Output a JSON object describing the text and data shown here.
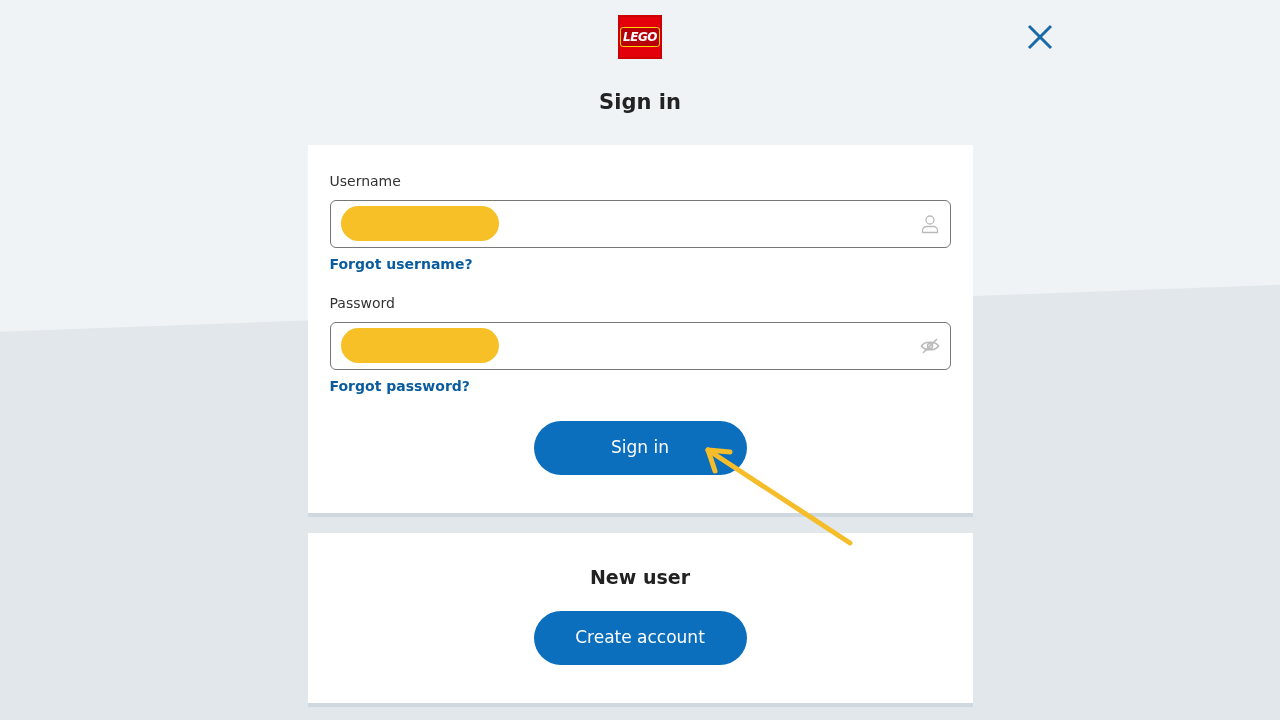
{
  "logo": {
    "text": "LEGO"
  },
  "title": "Sign in",
  "fields": [
    {
      "label": "Username",
      "kind": "user",
      "redacted": true,
      "link": "Forgot username?"
    },
    {
      "label": "Password",
      "kind": "password",
      "redacted": true,
      "link": "Forgot password?"
    }
  ],
  "sign_in_button": "Sign in",
  "new_user": {
    "heading": "New user",
    "button": "Create account"
  },
  "annotation": {
    "kind": "arrow"
  }
}
